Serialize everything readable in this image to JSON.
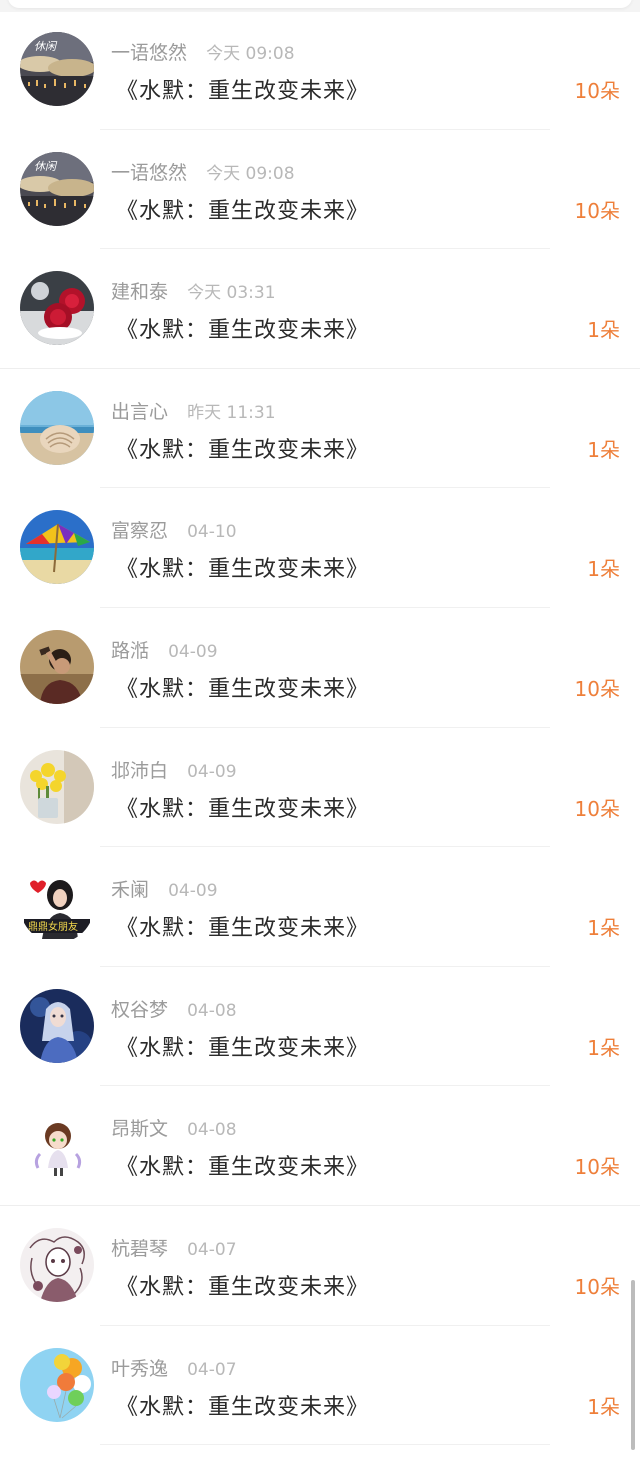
{
  "gift_list": {
    "rows": [
      {
        "name": "一语悠然",
        "time": "今天 09:08",
        "title": "《水默：重生改变未来》",
        "amount": "10朵"
      },
      {
        "name": "一语悠然",
        "time": "今天 09:08",
        "title": "《水默：重生改变未来》",
        "amount": "10朵"
      },
      {
        "name": "建和泰",
        "time": "今天 03:31",
        "title": "《水默：重生改变未来》",
        "amount": "1朵"
      },
      {
        "name": "出言心",
        "time": "昨天 11:31",
        "title": "《水默：重生改变未来》",
        "amount": "1朵"
      },
      {
        "name": "富察忍",
        "time": "04-10",
        "title": "《水默：重生改变未来》",
        "amount": "1朵"
      },
      {
        "name": "路湉",
        "time": "04-09",
        "title": "《水默：重生改变未来》",
        "amount": "10朵"
      },
      {
        "name": "邶沛白",
        "time": "04-09",
        "title": "《水默：重生改变未来》",
        "amount": "10朵"
      },
      {
        "name": "禾阑",
        "time": "04-09",
        "title": "《水默：重生改变未来》",
        "amount": "1朵"
      },
      {
        "name": "权谷梦",
        "time": "04-08",
        "title": "《水默：重生改变未来》",
        "amount": "1朵"
      },
      {
        "name": "昂斯文",
        "time": "04-08",
        "title": "《水默：重生改变未来》",
        "amount": "10朵"
      },
      {
        "name": "杭碧琴",
        "time": "04-07",
        "title": "《水默：重生改变未来》",
        "amount": "10朵"
      },
      {
        "name": "叶秀逸",
        "time": "04-07",
        "title": "《水默：重生改变未来》",
        "amount": "1朵"
      }
    ]
  },
  "avatar_art": {
    "cloud_city": "lettering on avatar: 休闲",
    "girl_badge": "lettering on avatar: 鼎鼎女朋友"
  },
  "colors": {
    "amount": "#ee7f3a",
    "name": "#9b9b9b",
    "time": "#b8b8b8",
    "title": "#2a2a2a"
  }
}
